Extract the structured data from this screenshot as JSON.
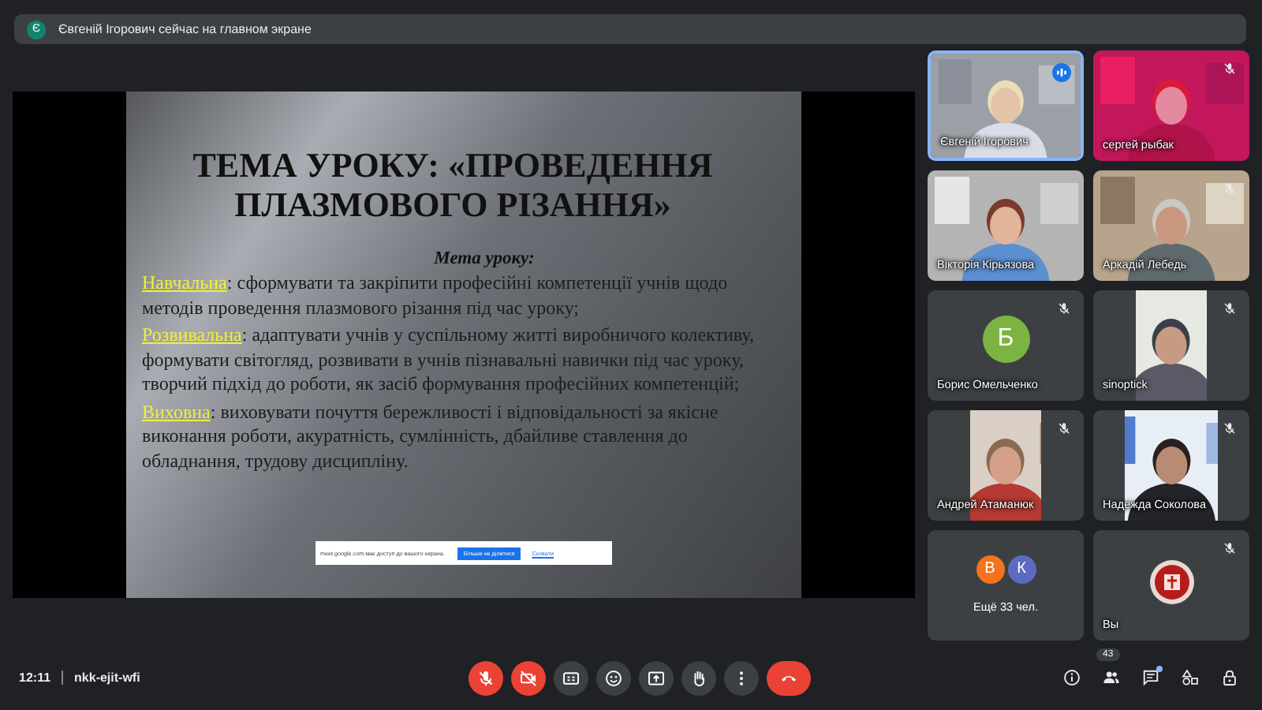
{
  "banner": {
    "avatar": "Є",
    "text": "Євгеній Ігорович сейчас на главном экране"
  },
  "slide": {
    "title": [
      "ТЕМА УРОКУ: «ПРОВЕДЕННЯ",
      "ПЛАЗМОВОГО РІЗАННЯ»"
    ],
    "subtitle": "Мета уроку:",
    "paragraphs": [
      {
        "label": "Навчальна",
        "text": ": сформувати та закріпити професійні компетенції учнів щодо методів проведення плазмового різання під час уроку;"
      },
      {
        "label": "Розвивальна",
        "text": ": адаптувати учнів у суспільному житті виробничого колективу, формувати світогляд, розвивати в учнів пізнавальні навички під час уроку, творчий підхід до роботи, як засіб формування професійних компетенцій;"
      },
      {
        "label": "Виховна",
        "text": ": виховувати  почуття бережливості і відповідальності за якісне виконання роботи, акуратність, сумлінність, дбайливе ставлення до обладнання, трудову дисципліну."
      }
    ]
  },
  "share_notice": {
    "text": "meet.google.com має доступ до вашого екрана.",
    "stop_button": "Більше не ділитися",
    "hide_link": "Сховати"
  },
  "tiles": [
    {
      "kind": "video",
      "name": "Євгеній Ігорович",
      "muted": false,
      "speaking": true
    },
    {
      "kind": "video",
      "name": "сергей рыбак",
      "muted": true,
      "speaking": false
    },
    {
      "kind": "video",
      "name": "Вікторія Кірьязова",
      "muted": false,
      "speaking": false
    },
    {
      "kind": "video",
      "name": "Аркадій Лебедь",
      "muted": true,
      "speaking": false
    },
    {
      "kind": "avatar",
      "name": "Борис Омельченко",
      "letter": "Б",
      "color": "#7cb342",
      "muted": true,
      "speaking": false
    },
    {
      "kind": "video",
      "name": "sinoptick",
      "muted": true,
      "speaking": false
    },
    {
      "kind": "video",
      "name": "Андрей Атаманюк",
      "muted": true,
      "speaking": false
    },
    {
      "kind": "video",
      "name": "Надежда Соколова",
      "muted": true,
      "speaking": false
    },
    {
      "kind": "others",
      "name": "Ещё 33 чел.",
      "avatars": [
        {
          "letter": "В",
          "color": "#f4731c"
        },
        {
          "letter": "К",
          "color": "#5c6bc0"
        }
      ],
      "muted": false,
      "speaking": false
    },
    {
      "kind": "self",
      "name": "Вы",
      "muted": true,
      "speaking": false
    }
  ],
  "footer": {
    "time": "12:11",
    "meeting_code": "nkk-ejit-wfi",
    "microphone_on": false,
    "camera_on": false,
    "participants_count": "43",
    "chat_unread": true
  }
}
